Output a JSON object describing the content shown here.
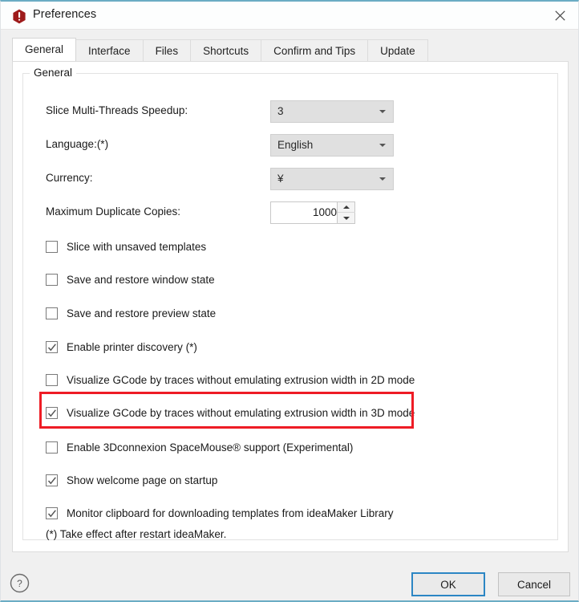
{
  "window": {
    "title": "Preferences",
    "icon": "app-warning-icon",
    "close_icon": "close-icon",
    "accent_color": "#6bacc4",
    "highlight_color": "#ee1c25"
  },
  "tabs": [
    {
      "label": "General",
      "active": true
    },
    {
      "label": "Interface",
      "active": false
    },
    {
      "label": "Files",
      "active": false
    },
    {
      "label": "Shortcuts",
      "active": false
    },
    {
      "label": "Confirm and Tips",
      "active": false
    },
    {
      "label": "Update",
      "active": false
    }
  ],
  "group": {
    "title": "General"
  },
  "fields": [
    {
      "label": "Slice Multi-Threads Speedup:",
      "value": "3",
      "type": "combobox"
    },
    {
      "label": "Language:(*)",
      "value": "English",
      "type": "combobox"
    },
    {
      "label": "Currency:",
      "value": "¥",
      "type": "combobox"
    },
    {
      "label": "Maximum Duplicate Copies:",
      "value": "1000",
      "type": "spinbox"
    }
  ],
  "checkboxes": [
    {
      "label": "Slice with unsaved templates",
      "checked": false
    },
    {
      "label": "Save and restore window state",
      "checked": false
    },
    {
      "label": "Save and restore preview state",
      "checked": false
    },
    {
      "label": "Enable printer discovery (*)",
      "checked": true
    },
    {
      "label": "Visualize GCode by traces without emulating extrusion width in 2D mode",
      "checked": false
    },
    {
      "label": "Visualize GCode by traces without emulating extrusion width in 3D mode",
      "checked": true
    },
    {
      "label": "Enable 3Dconnexion SpaceMouse® support (Experimental)",
      "checked": false
    },
    {
      "label": "Show welcome page on startup",
      "checked": true
    },
    {
      "label": "Monitor clipboard for downloading templates from ideaMaker Library",
      "checked": true
    }
  ],
  "footnote": "(*) Take effect after restart ideaMaker.",
  "footer": {
    "help_icon": "help-circle-icon",
    "ok_label": "OK",
    "cancel_label": "Cancel"
  }
}
